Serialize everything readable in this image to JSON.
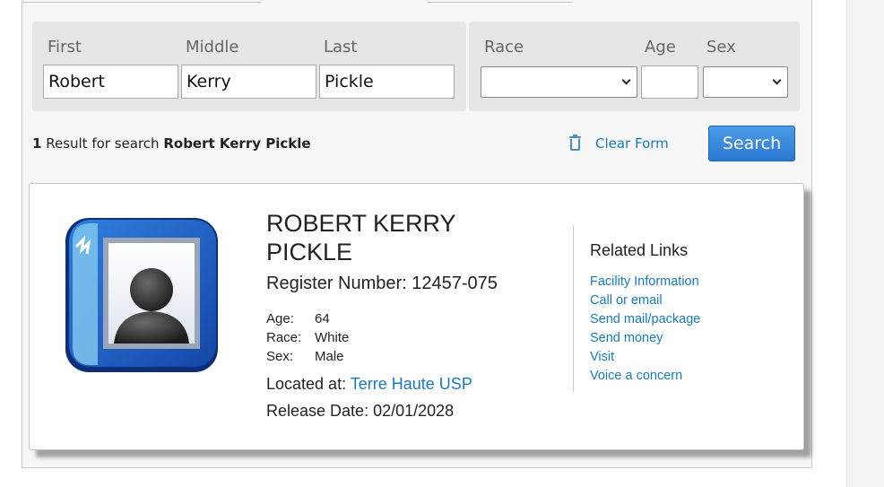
{
  "search_form": {
    "first_label": "First",
    "middle_label": "Middle",
    "last_label": "Last",
    "first_value": "Robert",
    "middle_value": "Kerry",
    "last_value": "Pickle",
    "race_label": "Race",
    "age_label": "Age",
    "sex_label": "Sex",
    "race_value": "",
    "age_value": "",
    "sex_value": ""
  },
  "results": {
    "count": "1",
    "text": "Result for search",
    "query": "Robert Kerry Pickle"
  },
  "actions": {
    "clear_form_label": "Clear Form",
    "search_label": "Search"
  },
  "inmate": {
    "name": "ROBERT KERRY PICKLE",
    "register_label": "Register Number:",
    "register_number": "12457-075",
    "age_label": "Age:",
    "age": "64",
    "race_label": "Race:",
    "race": "White",
    "sex_label": "Sex:",
    "sex": "Male",
    "located_label": "Located at:",
    "facility": "Terre Haute USP",
    "release_label": "Release Date:",
    "release_date": "02/01/2028"
  },
  "related_links": {
    "title": "Related Links",
    "items": [
      "Facility Information",
      "Call or email",
      "Send mail/package",
      "Send money",
      "Visit",
      "Voice a concern"
    ]
  },
  "colors": {
    "link": "#1a7ab8",
    "button": "#3a8ad8"
  },
  "icons": {
    "clear": "trash-icon",
    "avatar": "person-photo-icon"
  }
}
